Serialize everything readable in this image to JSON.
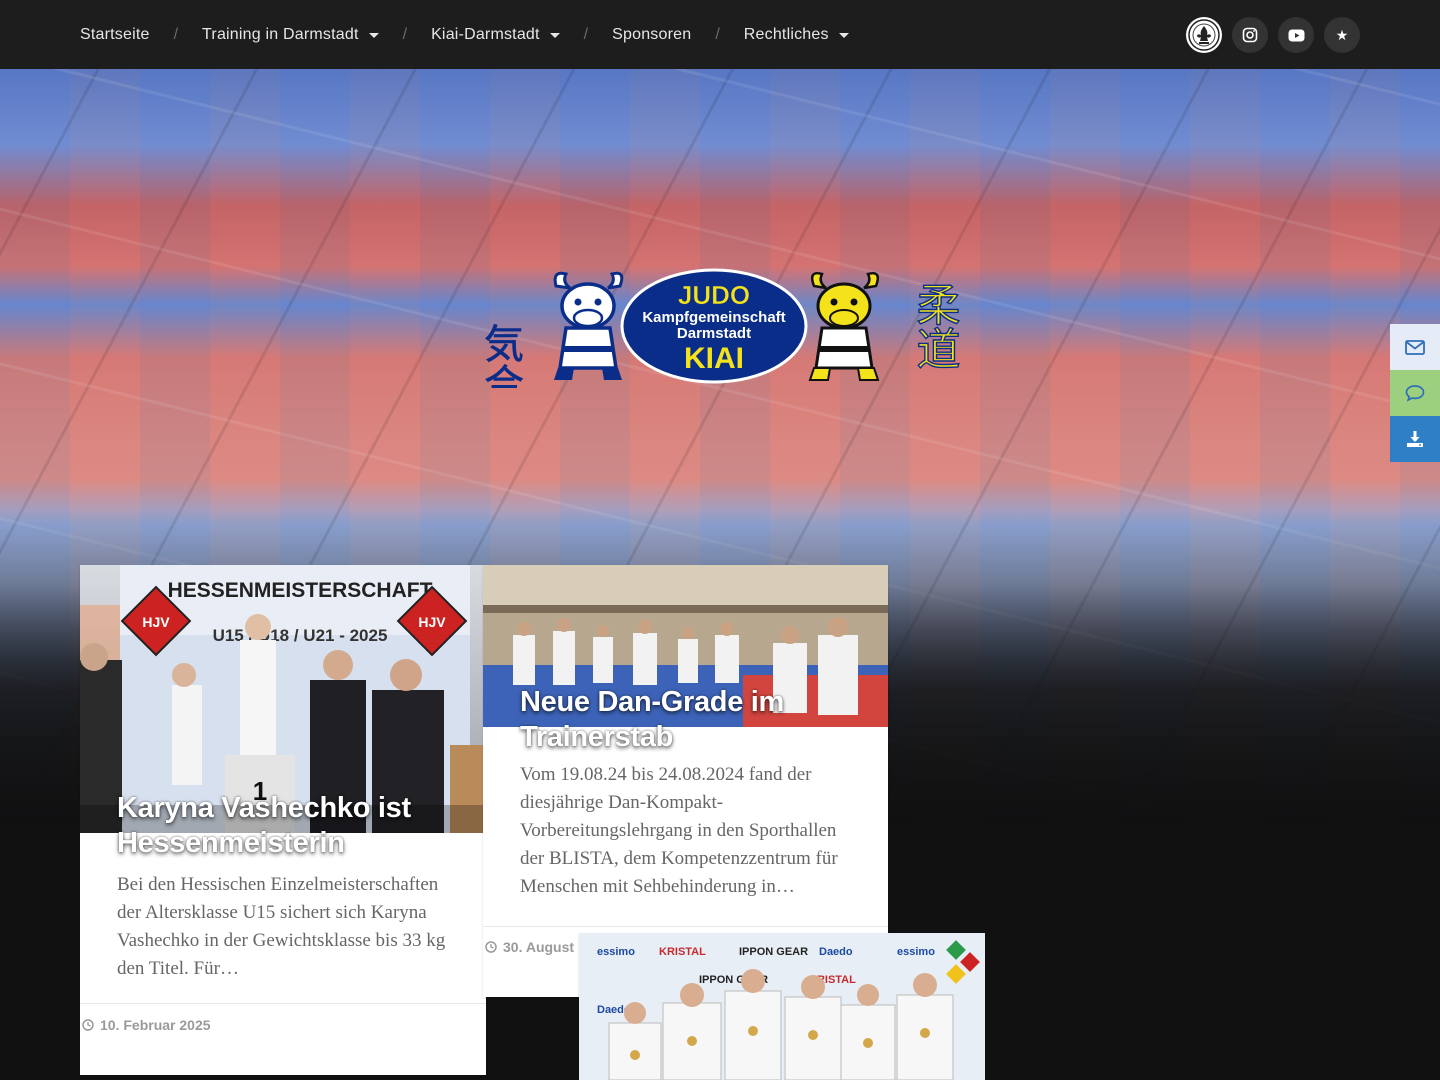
{
  "nav": {
    "items": [
      {
        "label": "Startseite",
        "dropdown": false
      },
      {
        "label": "Training in Darmstadt",
        "dropdown": true
      },
      {
        "label": "Kiai-Darmstadt",
        "dropdown": true
      },
      {
        "label": "Sponsoren",
        "dropdown": false
      },
      {
        "label": "Rechtliches",
        "dropdown": true
      }
    ],
    "separator": "/"
  },
  "social": {
    "icons": [
      "darmstadt-crest-icon",
      "instagram-icon",
      "youtube-icon",
      "star-icon"
    ],
    "star_glyph": "★"
  },
  "logo": {
    "word_top": "JUDO",
    "line1": "Kampfgemeinschaft",
    "line2": "Darmstadt",
    "word_bottom": "KIAI",
    "kanji_left": "気合",
    "kanji_right": "柔道",
    "colors": {
      "navy": "#0b2d8a",
      "yellow": "#f4e21a"
    }
  },
  "side_actions": {
    "icons": [
      "mail-icon",
      "chat-icon",
      "download-icon"
    ],
    "colors": {
      "mail": "#e6ecf7",
      "chat": "#9ccf7e",
      "download": "#2f7fc7"
    }
  },
  "posts": [
    {
      "title": "Karyna Vashechko ist Hessenmeisterin",
      "excerpt": "Bei den Hessischen Einzelmeisterschaften der Altersklasse U15 sichert sich Karyna Vashechko in der Gewichtsklasse bis 33 kg den Titel. Für…",
      "date": "10. Februar 2025",
      "banner_text": "HESSENMEISTERSCHAFT",
      "banner_sub": "U15 / U18 / U21 - 2025",
      "banner_badge": "HJV",
      "podium_number": "1"
    },
    {
      "title": "Neue Dan-Grade im Trainerstab",
      "excerpt": "Vom 19.08.24 bis 24.08.2024 fand der diesjährige Dan-Kompakt-Vorbereitungslehrgang in den Sporthallen der BLISTA, dem Kompetenzzentrum für Menschen mit Sehbehinderung in…",
      "date": "30. August"
    },
    {
      "sponsor_texts": [
        "essimo",
        "KRISTAL",
        "IPPON GEAR",
        "Daedo"
      ]
    }
  ]
}
